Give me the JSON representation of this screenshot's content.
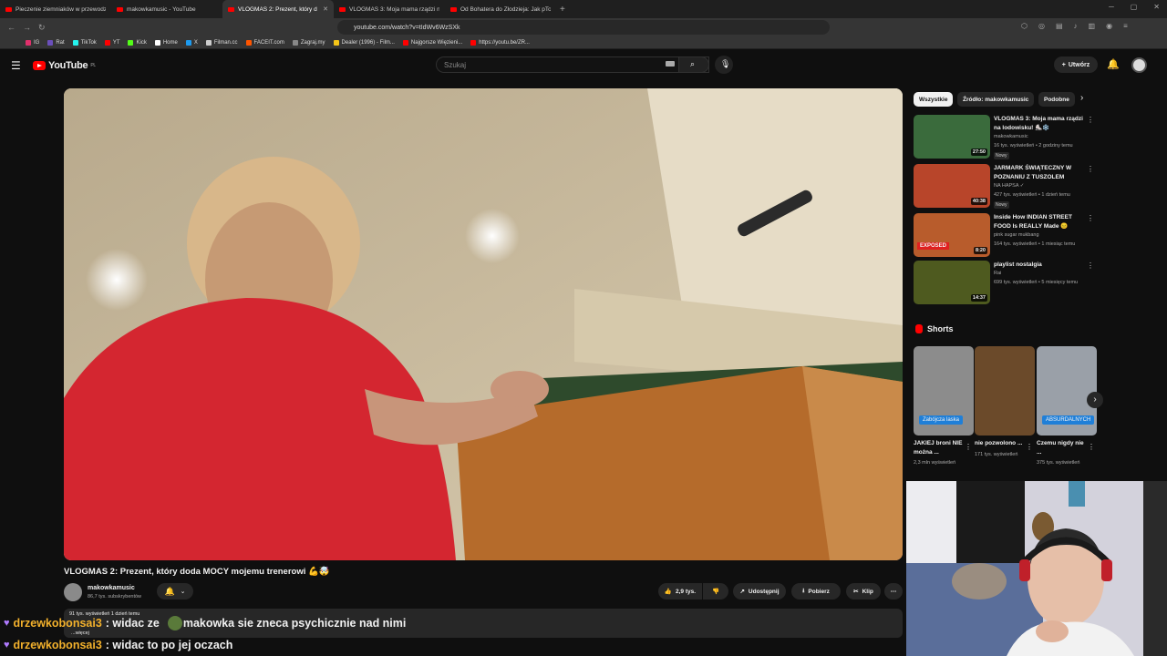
{
  "browser": {
    "tabs": [
      {
        "label": "Pieczenie ziemniaków w przewodzie"
      },
      {
        "label": "makowkamusic - YouTube"
      },
      {
        "label": "VLOGMAS 2: Prezent, który d",
        "active": true
      },
      {
        "label": "VLOGMAS 3: Moja mama rządzi na l"
      },
      {
        "label": "Od Bohatera do Złodzieja: Jak pTome"
      }
    ],
    "new_tab": "+",
    "url": "youtube.com/watch?v=tIdWv6WzSXk",
    "bookmarks": [
      {
        "label": "IG",
        "color": "#e1306c"
      },
      {
        "label": "Rat",
        "color": "#6b4fbb"
      },
      {
        "label": "TikTok",
        "color": "#25f4ee"
      },
      {
        "label": "YT",
        "color": "#ff0000"
      },
      {
        "label": "Kick",
        "color": "#53fc18"
      },
      {
        "label": "Home",
        "color": "#ffffff"
      },
      {
        "label": "X",
        "color": "#1d9bf0"
      },
      {
        "label": "Filman.cc",
        "color": "#cccccc"
      },
      {
        "label": "FACEIT.com",
        "color": "#ff5500"
      },
      {
        "label": "Zagraj.my",
        "color": "#888888"
      },
      {
        "label": "Dealer (1996) - Film...",
        "color": "#f5c518"
      },
      {
        "label": "Najgorsze Więzieni...",
        "color": "#ff0000"
      },
      {
        "label": "https://youtu.be/ZR...",
        "color": "#ff0000"
      }
    ]
  },
  "youtube": {
    "logo": "YouTube",
    "country": "PL",
    "search_placeholder": "Szukaj",
    "create_label": "Utwórz"
  },
  "video": {
    "title": "VLOGMAS 2: Prezent, który doda MOCY mojemu trenerowi 💪🤯",
    "channel": "makowkamusic",
    "subscribers": "86,7 tys. subskrybentów",
    "likes": "2,9 tys.",
    "share": "Udostępnij",
    "download": "Pobierz",
    "clip": "Klip",
    "views_date": "91 tys. wyświetleń  1 dzień temu",
    "more": "...więcej"
  },
  "sidebar": {
    "chips": [
      "Wszystkie",
      "Źródło: makowkamusic",
      "Podobne"
    ],
    "recommendations": [
      {
        "title": "VLOGMAS 3: Moja mama rządzi na lodowisku! ⛸️❄️",
        "channel": "makowkamusic",
        "meta": "16 tys. wyświetleń • 2 godziny temu",
        "badge": "Nowy",
        "duration": "27:50",
        "thumb": "#3a6b3c"
      },
      {
        "title": "JARMARK ŚWIĄTECZNY W POZNANIU Z TUSZOLEM",
        "channel": "NA HAPSA ✓",
        "meta": "427 tys. wyświetleń • 1 dzień temu",
        "badge": "Nowy",
        "duration": "40:38",
        "thumb": "#b8452a"
      },
      {
        "title": "Inside How INDIAN STREET FOOD Is REALLY Made 😐",
        "channel": "pink sugar mukbang",
        "meta": "164 tys. wyświetleń • 1 miesiąc temu",
        "badge": "",
        "duration": "8:20",
        "thumb": "#b85c2c",
        "label": "EXPOSED"
      },
      {
        "title": "playlist nostalgia",
        "channel": "Rai",
        "meta": "699 tys. wyświetleń • 5 miesięcy temu",
        "badge": "",
        "duration": "14:37",
        "thumb": "#4e5a1f"
      }
    ],
    "shorts_title": "Shorts",
    "shorts": [
      {
        "title": "JAKIEJ broni NIE można ...",
        "views": "2,3 mln wyświetleń",
        "thumb": "#8c8c8c",
        "tag": "Zabójcza laska"
      },
      {
        "title": "nie pozwolono ...",
        "views": "171 tys. wyświetleń",
        "thumb": "#6b4a2a",
        "tag": ""
      },
      {
        "title": "Czemu nigdy nie ...",
        "views": "375 tys. wyświetleń",
        "thumb": "#9aa0a8",
        "tag": "ABSURDALNYCH"
      }
    ]
  },
  "chat": [
    {
      "user": "drzewkobonsai3",
      "message": ": widac ze",
      "extra": "makowka sie zneca psychicznie nad nimi"
    },
    {
      "user": "drzewkobonsai3",
      "message": ": widac to po jej oczach"
    }
  ],
  "colors": {
    "accent": "#ff0000",
    "chat_user": "#f3b12c",
    "chat_heart": "#b07bff"
  }
}
